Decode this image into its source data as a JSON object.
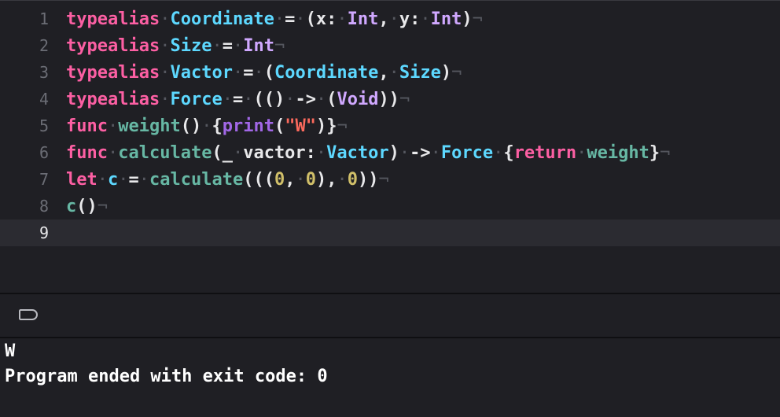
{
  "editor": {
    "lines": [
      {
        "num": "1",
        "tokens": [
          [
            "kw",
            "typealias"
          ],
          [
            "dot",
            "·"
          ],
          [
            "ty",
            "Coordinate"
          ],
          [
            "dot",
            "·"
          ],
          [
            "pl",
            "="
          ],
          [
            "dot",
            "·"
          ],
          [
            "pl",
            "(x:"
          ],
          [
            "dot",
            "·"
          ],
          [
            "tyw",
            "Int"
          ],
          [
            "pl",
            ","
          ],
          [
            "dot",
            "·"
          ],
          [
            "pl",
            "y:"
          ],
          [
            "dot",
            "·"
          ],
          [
            "tyw",
            "Int"
          ],
          [
            "pl",
            ")"
          ],
          [
            "inv",
            "¬"
          ]
        ]
      },
      {
        "num": "2",
        "tokens": [
          [
            "kw",
            "typealias"
          ],
          [
            "dot",
            "·"
          ],
          [
            "ty",
            "Size"
          ],
          [
            "dot",
            "·"
          ],
          [
            "pl",
            "="
          ],
          [
            "dot",
            "·"
          ],
          [
            "tyw",
            "Int"
          ],
          [
            "inv",
            "¬"
          ]
        ]
      },
      {
        "num": "3",
        "tokens": [
          [
            "kw",
            "typealias"
          ],
          [
            "dot",
            "·"
          ],
          [
            "ty",
            "Vactor"
          ],
          [
            "dot",
            "·"
          ],
          [
            "pl",
            "="
          ],
          [
            "dot",
            "·"
          ],
          [
            "pl",
            "("
          ],
          [
            "ty",
            "Coordinate"
          ],
          [
            "pl",
            ","
          ],
          [
            "dot",
            "·"
          ],
          [
            "ty",
            "Size"
          ],
          [
            "pl",
            ")"
          ],
          [
            "inv",
            "¬"
          ]
        ]
      },
      {
        "num": "4",
        "tokens": [
          [
            "kw",
            "typealias"
          ],
          [
            "dot",
            "·"
          ],
          [
            "ty",
            "Force"
          ],
          [
            "dot",
            "·"
          ],
          [
            "pl",
            "="
          ],
          [
            "dot",
            "·"
          ],
          [
            "pl",
            "(()"
          ],
          [
            "dot",
            "·"
          ],
          [
            "pl",
            "->"
          ],
          [
            "dot",
            "·"
          ],
          [
            "pl",
            "("
          ],
          [
            "tyw",
            "Void"
          ],
          [
            "pl",
            "))"
          ],
          [
            "inv",
            "¬"
          ]
        ]
      },
      {
        "num": "5",
        "tokens": [
          [
            "kw",
            "func"
          ],
          [
            "dot",
            "·"
          ],
          [
            "fn",
            "weight"
          ],
          [
            "pl",
            "()"
          ],
          [
            "dot",
            "·"
          ],
          [
            "pl",
            "{"
          ],
          [
            "pr",
            "print"
          ],
          [
            "pl",
            "("
          ],
          [
            "str",
            "\"W\""
          ],
          [
            "pl",
            ")}"
          ],
          [
            "inv",
            "¬"
          ]
        ]
      },
      {
        "num": "6",
        "tokens": [
          [
            "kw",
            "func"
          ],
          [
            "dot",
            "·"
          ],
          [
            "fn",
            "calculate"
          ],
          [
            "pl",
            "(_"
          ],
          [
            "dot",
            "·"
          ],
          [
            "pl",
            "vactor:"
          ],
          [
            "dot",
            "·"
          ],
          [
            "ty",
            "Vactor"
          ],
          [
            "pl",
            ")"
          ],
          [
            "dot",
            "·"
          ],
          [
            "pl",
            "->"
          ],
          [
            "dot",
            "·"
          ],
          [
            "ty",
            "Force"
          ],
          [
            "dot",
            "·"
          ],
          [
            "pl",
            "{"
          ],
          [
            "kw",
            "return"
          ],
          [
            "dot",
            "·"
          ],
          [
            "fn",
            "weight"
          ],
          [
            "pl",
            "}"
          ],
          [
            "inv",
            "¬"
          ]
        ]
      },
      {
        "num": "7",
        "tokens": [
          [
            "kw",
            "let"
          ],
          [
            "dot",
            "·"
          ],
          [
            "ty",
            "c"
          ],
          [
            "dot",
            "·"
          ],
          [
            "pl",
            "="
          ],
          [
            "dot",
            "·"
          ],
          [
            "fn",
            "calculate"
          ],
          [
            "pl",
            "((("
          ],
          [
            "num",
            "0"
          ],
          [
            "pl",
            ","
          ],
          [
            "dot",
            "·"
          ],
          [
            "num",
            "0"
          ],
          [
            "pl",
            "),"
          ],
          [
            "dot",
            "·"
          ],
          [
            "num",
            "0"
          ],
          [
            "pl",
            "))"
          ],
          [
            "inv",
            "¬"
          ]
        ]
      },
      {
        "num": "8",
        "tokens": [
          [
            "fn",
            "c"
          ],
          [
            "pl",
            "()"
          ],
          [
            "inv",
            "¬"
          ]
        ]
      },
      {
        "num": "9",
        "tokens": []
      }
    ]
  },
  "console": {
    "lines": [
      "W",
      "Program ended with exit code: 0"
    ]
  },
  "icons": {
    "output_filter": "tag-icon"
  }
}
